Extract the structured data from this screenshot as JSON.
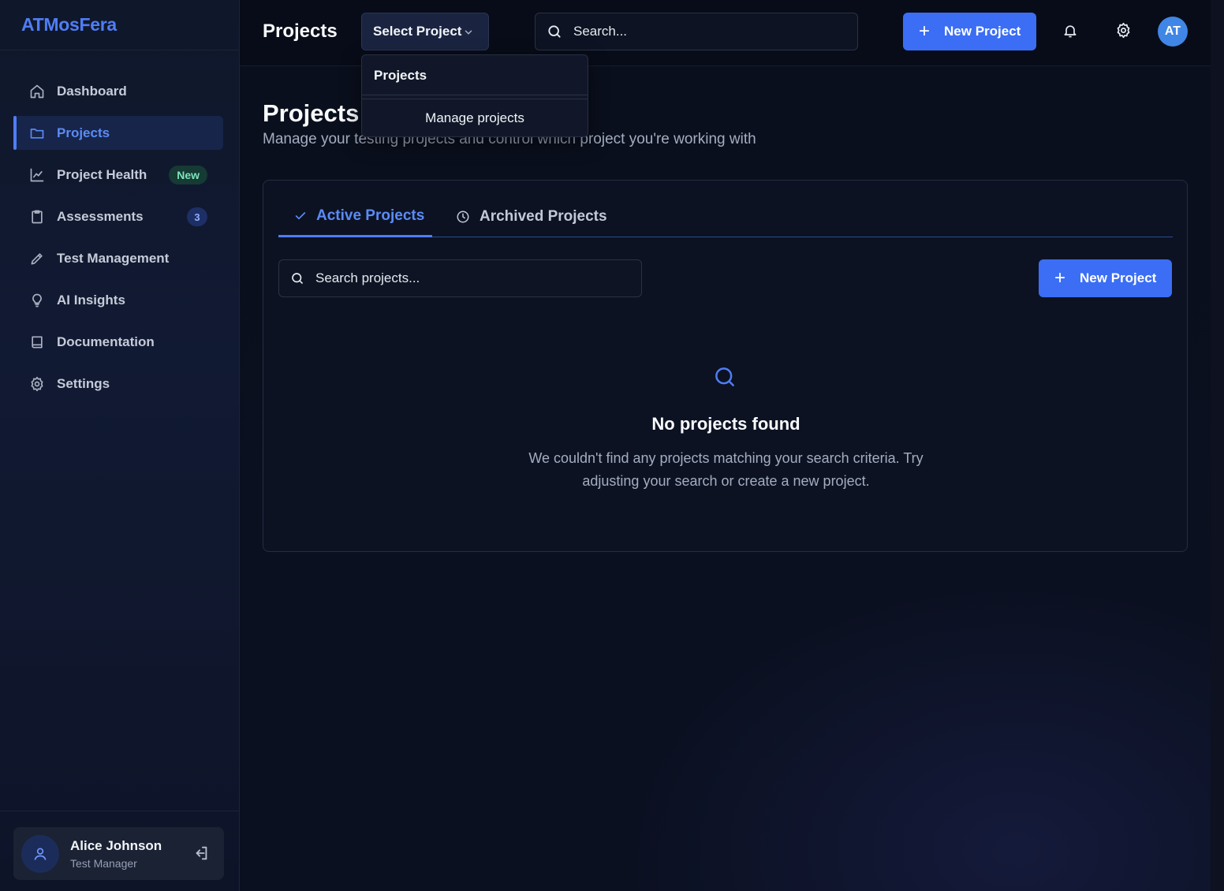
{
  "app": {
    "brand": "ATMosFera"
  },
  "sidebar": {
    "items": [
      {
        "label": "Dashboard",
        "icon": "home-icon"
      },
      {
        "label": "Projects",
        "icon": "folder-icon",
        "active": true
      },
      {
        "label": "Project Health",
        "icon": "chart-line-icon",
        "badge": "New"
      },
      {
        "label": "Assessments",
        "icon": "clipboard-icon",
        "badge": "3"
      },
      {
        "label": "Test Management",
        "icon": "pencil-icon"
      },
      {
        "label": "AI Insights",
        "icon": "lightbulb-icon"
      },
      {
        "label": "Documentation",
        "icon": "book-icon"
      },
      {
        "label": "Settings",
        "icon": "gear-icon"
      }
    ],
    "user": {
      "name": "Alice Johnson",
      "role": "Test Manager"
    }
  },
  "topbar": {
    "title": "Projects",
    "select_project": "Select Project",
    "search_placeholder": "Search...",
    "new_project": "New Project",
    "avatar_initials": "AT"
  },
  "dropdown": {
    "header": "Projects",
    "item": "Manage projects"
  },
  "main": {
    "title": "Projects",
    "subtitle": "Manage your testing projects and control which project you're working with",
    "tabs": [
      {
        "label": "Active Projects",
        "active": true
      },
      {
        "label": "Archived Projects"
      }
    ],
    "search_placeholder": "Search projects...",
    "new_project": "New Project",
    "empty": {
      "title": "No projects found",
      "description": "We couldn't find any projects matching your search criteria. Try adjusting your search or create a new project."
    }
  },
  "colors": {
    "accent": "#3b6ef5",
    "background": "#0b1020",
    "sidebar_active": "#17254a",
    "badge_new": "#163a34"
  }
}
